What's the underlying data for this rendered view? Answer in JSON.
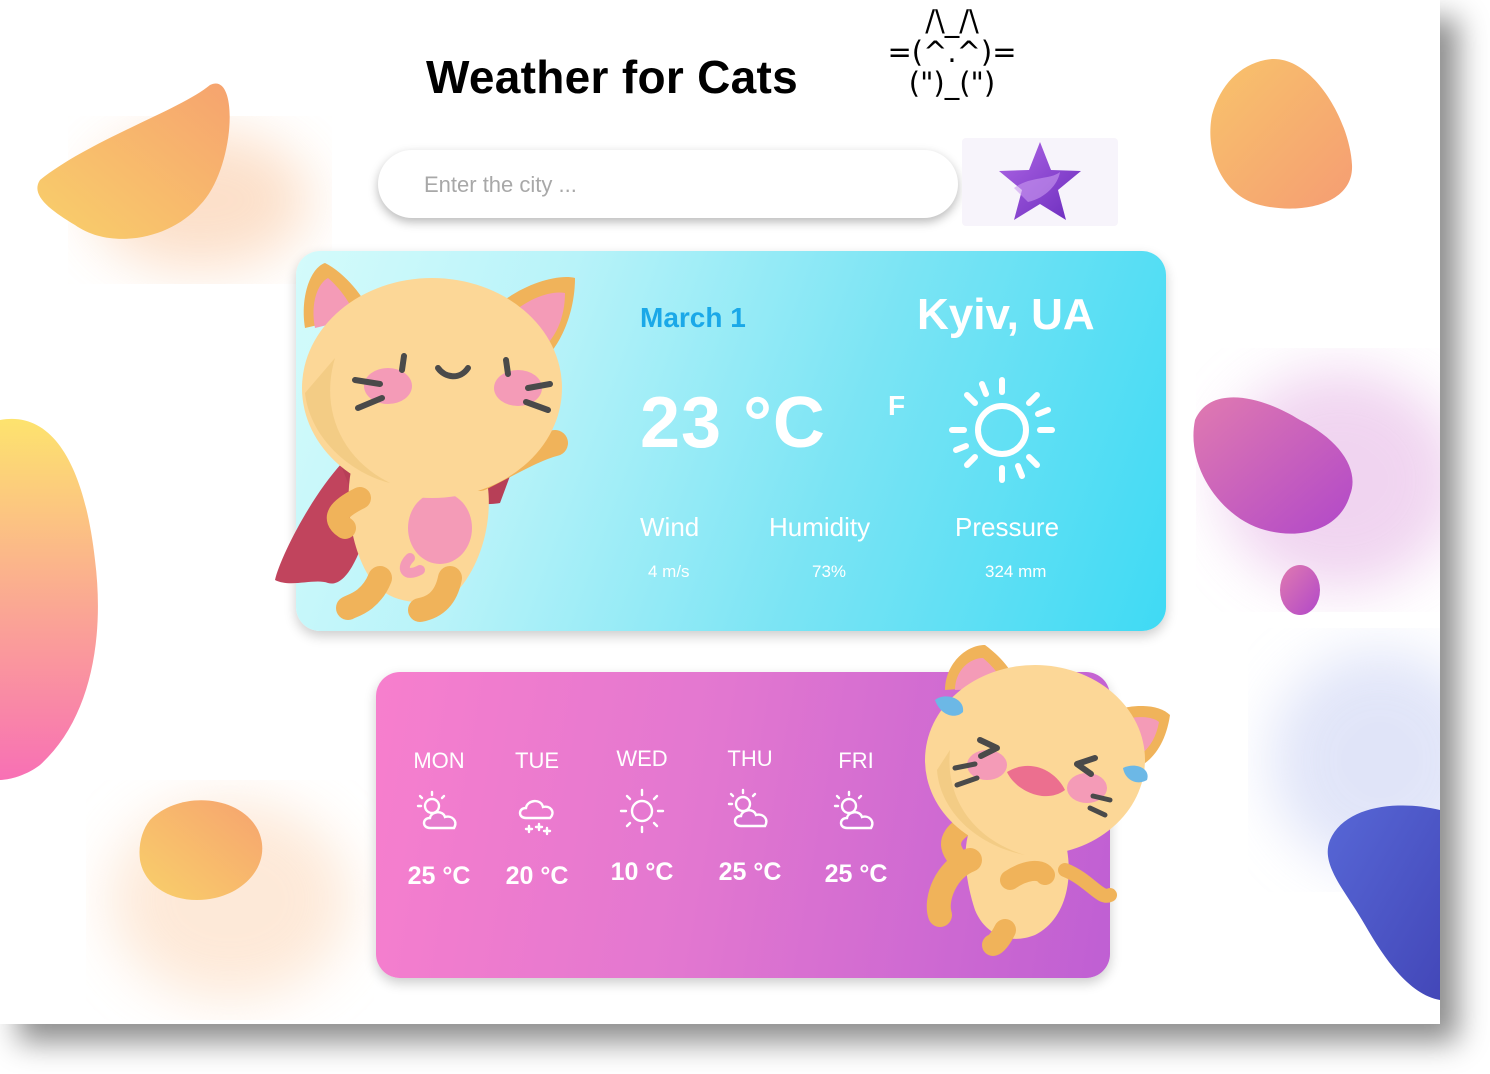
{
  "app": {
    "title": "Weather for Cats",
    "ascii_cat": [
      "/\\_/\\",
      "=(^.^)=",
      "(\")_(\")"
    ]
  },
  "search": {
    "placeholder": "Enter the city ...",
    "value": "",
    "favorite_icon": "star-icon"
  },
  "current": {
    "date": "March 1",
    "city": "Kyiv, UA",
    "temperature": "23 °C",
    "unit_toggle": "F",
    "condition_icon": "sun-icon",
    "wind": {
      "label": "Wind",
      "value": "4 m/s"
    },
    "humidity": {
      "label": "Humidity",
      "value": "73%"
    },
    "pressure": {
      "label": "Pressure",
      "value": "324 mm"
    }
  },
  "forecast": [
    {
      "day": "MON",
      "icon": "partly-cloudy-icon",
      "temp": "25 °C"
    },
    {
      "day": "TUE",
      "icon": "snow-cloud-icon",
      "temp": "20 °C"
    },
    {
      "day": "WED",
      "icon": "sun-icon",
      "temp": "10 °C"
    },
    {
      "day": "THU",
      "icon": "partly-cloudy-icon",
      "temp": "25 °C"
    },
    {
      "day": "FRI",
      "icon": "partly-cloudy-icon",
      "temp": "25 °C"
    }
  ],
  "colors": {
    "main_card_gradient": [
      "#d4fbfb",
      "#3fdaf4"
    ],
    "week_card_gradient": [
      "#f77fcd",
      "#bf5fd3"
    ],
    "date_accent": "#1aa8e8"
  }
}
